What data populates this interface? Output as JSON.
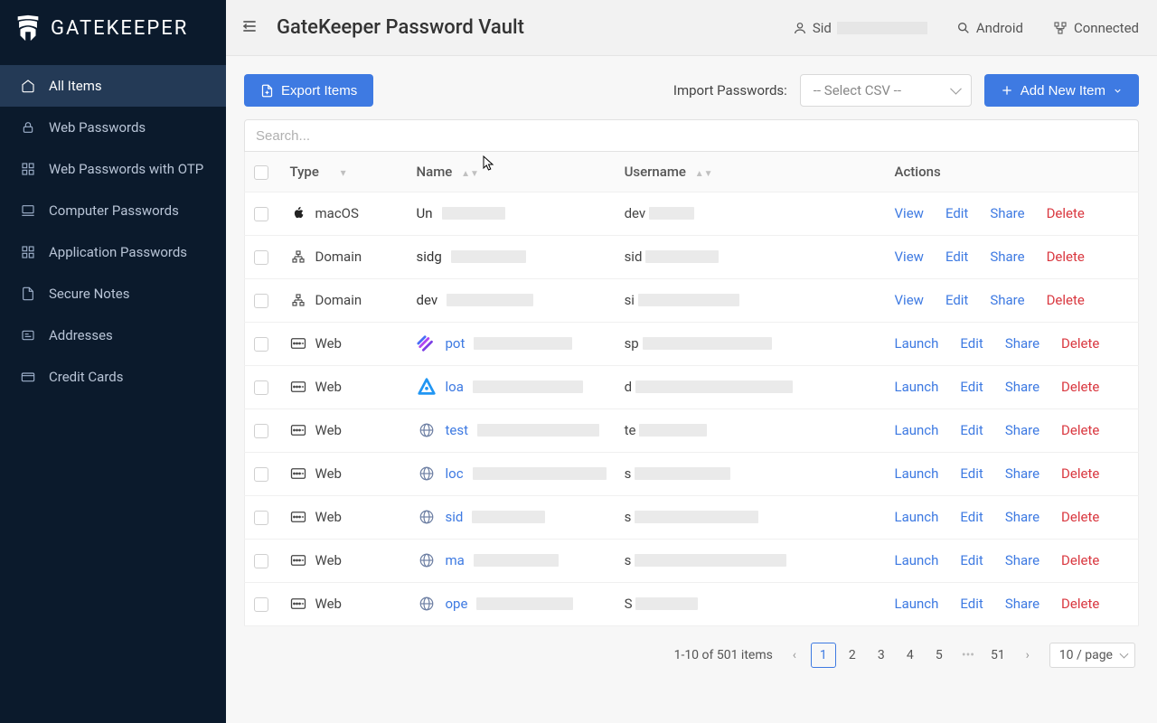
{
  "brand": "GATEKEEPER",
  "sidebar": {
    "items": [
      {
        "label": "All Items"
      },
      {
        "label": "Web Passwords"
      },
      {
        "label": "Web Passwords with OTP"
      },
      {
        "label": "Computer Passwords"
      },
      {
        "label": "Application Passwords"
      },
      {
        "label": "Secure Notes"
      },
      {
        "label": "Addresses"
      },
      {
        "label": "Credit Cards"
      }
    ]
  },
  "header": {
    "title": "GateKeeper Password Vault",
    "user_prefix": "Sid",
    "device": "Android",
    "status": "Connected"
  },
  "toolbar": {
    "export_label": "Export Items",
    "import_label": "Import Passwords:",
    "import_placeholder": "-- Select CSV --",
    "add_label": "Add New Item"
  },
  "search": {
    "placeholder": "Search..."
  },
  "columns": {
    "type": "Type",
    "name": "Name",
    "username": "Username",
    "actions": "Actions"
  },
  "actions": {
    "view": "View",
    "launch": "Launch",
    "edit": "Edit",
    "share": "Share",
    "delete": "Delete"
  },
  "rows": [
    {
      "type": "macOS",
      "type_icon": "apple",
      "fav": "none",
      "name_prefix": "Un",
      "name_link": false,
      "user_prefix": "dev",
      "primary": "view"
    },
    {
      "type": "Domain",
      "type_icon": "domain",
      "fav": "none",
      "name_prefix": "sidg",
      "name_link": false,
      "user_prefix": "sid",
      "primary": "view"
    },
    {
      "type": "Domain",
      "type_icon": "domain",
      "fav": "none",
      "name_prefix": "dev",
      "name_link": false,
      "user_prefix": "si",
      "primary": "view"
    },
    {
      "type": "Web",
      "type_icon": "web",
      "fav": "purple",
      "name_prefix": "pot",
      "name_link": true,
      "user_prefix": "sp",
      "primary": "launch"
    },
    {
      "type": "Web",
      "type_icon": "web",
      "fav": "blue-tri",
      "name_prefix": "loa",
      "name_link": true,
      "user_prefix": "d",
      "primary": "launch"
    },
    {
      "type": "Web",
      "type_icon": "web",
      "fav": "globe",
      "name_prefix": "test",
      "name_link": true,
      "user_prefix": "te",
      "primary": "launch"
    },
    {
      "type": "Web",
      "type_icon": "web",
      "fav": "globe",
      "name_prefix": "loc",
      "name_link": true,
      "user_prefix": "s",
      "primary": "launch"
    },
    {
      "type": "Web",
      "type_icon": "web",
      "fav": "globe",
      "name_prefix": "sid",
      "name_link": true,
      "user_prefix": "s",
      "primary": "launch"
    },
    {
      "type": "Web",
      "type_icon": "web",
      "fav": "globe",
      "name_prefix": "ma",
      "name_link": true,
      "user_prefix": "s",
      "primary": "launch"
    },
    {
      "type": "Web",
      "type_icon": "web",
      "fav": "globe",
      "name_prefix": "ope",
      "name_link": true,
      "user_prefix": "S",
      "primary": "launch"
    }
  ],
  "pagination": {
    "summary": "1-10 of 501 items",
    "pages": [
      "1",
      "2",
      "3",
      "4",
      "5",
      "…",
      "51"
    ],
    "active": "1",
    "page_size": "10 / page"
  }
}
